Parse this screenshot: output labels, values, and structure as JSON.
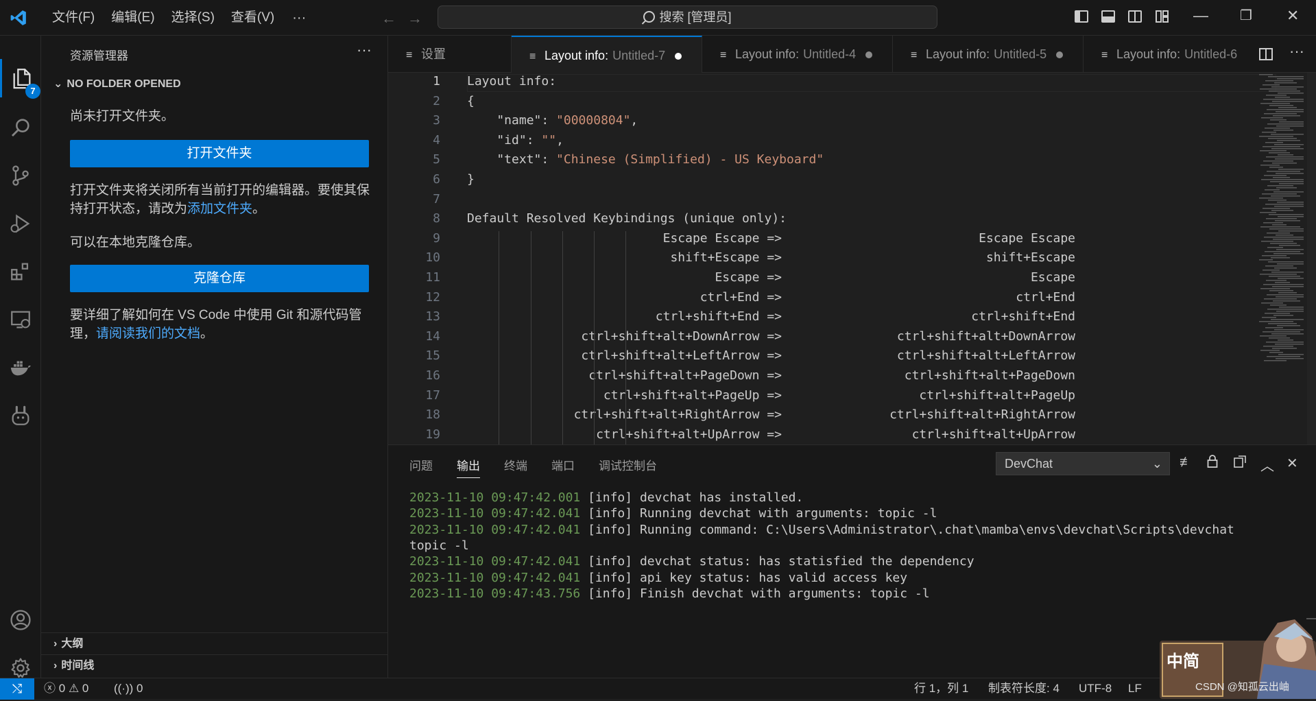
{
  "titlebar": {
    "menus": [
      "文件(F)",
      "编辑(E)",
      "选择(S)",
      "查看(V)"
    ],
    "more": "···",
    "search_text": "搜索 [管理员]",
    "back_icon": "arrow-left-icon",
    "forward_icon": "arrow-right-icon"
  },
  "activity": {
    "explorer_badge": "7",
    "items": [
      "explorer",
      "search",
      "source-control",
      "run-debug",
      "extensions",
      "remote-explorer",
      "docker",
      "devchat",
      "accounts",
      "manage"
    ]
  },
  "sidebar": {
    "title": "资源管理器",
    "more": "···",
    "section": "NO FOLDER OPENED",
    "no_folder_text": "尚未打开文件夹。",
    "open_folder_button": "打开文件夹",
    "close_editors_text": "打开文件夹将关闭所有当前打开的编辑器。要使其保持打开状态，请改为",
    "add_folder_link": "添加文件夹",
    "period": "。",
    "clone_text": "可以在本地克隆仓库。",
    "clone_button": "克隆仓库",
    "git_text": "要详细了解如何在 VS Code 中使用 Git 和源代码管理，",
    "docs_link": "请阅读我们的文档",
    "outline": "大纲",
    "timeline": "时间线"
  },
  "tabs": [
    {
      "label": "设置",
      "desc": "",
      "dirty": false,
      "active": false
    },
    {
      "label": "Layout info:",
      "desc": "Untitled-7",
      "dirty": true,
      "active": true
    },
    {
      "label": "Layout info:",
      "desc": "Untitled-4",
      "dirty": true,
      "active": false
    },
    {
      "label": "Layout info:",
      "desc": "Untitled-5",
      "dirty": true,
      "active": false
    },
    {
      "label": "Layout info:",
      "desc": "Untitled-6",
      "dirty": false,
      "active": false
    }
  ],
  "editor": {
    "lines": [
      {
        "n": "1",
        "text": "Layout info:"
      },
      {
        "n": "2",
        "text": "{"
      },
      {
        "n": "3",
        "key": "    \"name\": ",
        "val": "\"00000804\"",
        "tail": ","
      },
      {
        "n": "4",
        "key": "    \"id\": ",
        "val": "\"\"",
        "tail": ","
      },
      {
        "n": "5",
        "key": "    \"text\": ",
        "val": "\"Chinese (Simplified) - US Keyboard\"",
        "tail": ""
      },
      {
        "n": "6",
        "text": "}"
      },
      {
        "n": "7",
        "text": ""
      },
      {
        "n": "8",
        "text": "Default Resolved Keybindings (unique only):"
      }
    ],
    "keybindings": [
      {
        "n": "9",
        "left": "Escape Escape =>",
        "right": "Escape Escape"
      },
      {
        "n": "10",
        "left": "shift+Escape =>",
        "right": "shift+Escape"
      },
      {
        "n": "11",
        "left": "Escape =>",
        "right": "Escape"
      },
      {
        "n": "12",
        "left": "ctrl+End =>",
        "right": "ctrl+End"
      },
      {
        "n": "13",
        "left": "ctrl+shift+End =>",
        "right": "ctrl+shift+End"
      },
      {
        "n": "14",
        "left": "ctrl+shift+alt+DownArrow =>",
        "right": "ctrl+shift+alt+DownArrow"
      },
      {
        "n": "15",
        "left": "ctrl+shift+alt+LeftArrow =>",
        "right": "ctrl+shift+alt+LeftArrow"
      },
      {
        "n": "16",
        "left": "ctrl+shift+alt+PageDown =>",
        "right": "ctrl+shift+alt+PageDown"
      },
      {
        "n": "17",
        "left": "ctrl+shift+alt+PageUp =>",
        "right": "ctrl+shift+alt+PageUp"
      },
      {
        "n": "18",
        "left": "ctrl+shift+alt+RightArrow =>",
        "right": "ctrl+shift+alt+RightArrow"
      },
      {
        "n": "19",
        "left": "ctrl+shift+alt+UpArrow =>",
        "right": "ctrl+shift+alt+UpArrow"
      }
    ]
  },
  "panel": {
    "tabs": [
      "问题",
      "输出",
      "终端",
      "端口",
      "调试控制台"
    ],
    "active_tab": "输出",
    "output_channel": "DevChat",
    "log": [
      {
        "ts": "2023-11-10 09:47:42.001",
        "msg": " [info] devchat has installed."
      },
      {
        "ts": "2023-11-10 09:47:42.041",
        "msg": " [info] Running devchat with arguments: topic -l"
      },
      {
        "ts": "2023-11-10 09:47:42.041",
        "msg": " [info] Running command: C:\\Users\\Administrator\\.chat\\mamba\\envs\\devchat\\Scripts\\devchat"
      },
      {
        "ts": "",
        "msg": "topic -l"
      },
      {
        "ts": "2023-11-10 09:47:42.041",
        "msg": " [info] devchat status: has statisfied the dependency"
      },
      {
        "ts": "2023-11-10 09:47:42.041",
        "msg": " [info] api key status: has valid access key"
      },
      {
        "ts": "2023-11-10 09:47:43.756",
        "msg": " [info] Finish devchat with arguments: topic -l"
      }
    ]
  },
  "statusbar": {
    "errors": "0",
    "warnings": "0",
    "ports": "0",
    "position": "行 1，列 1",
    "tab_size": "制表符长度: 4",
    "encoding": "UTF-8",
    "eol": "LF"
  },
  "overlay": {
    "ime_label": "中简",
    "watermark": "CSDN @知孤云出岫"
  },
  "colors": {
    "accent": "#0078d4",
    "string": "#ce9178",
    "timestamp": "#6a9955"
  }
}
